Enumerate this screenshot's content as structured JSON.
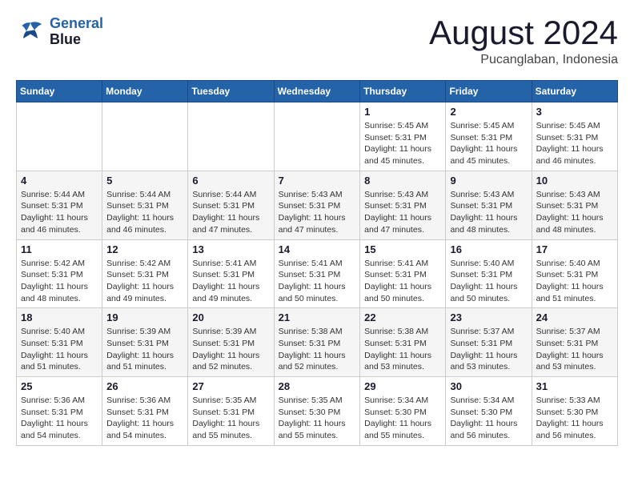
{
  "header": {
    "logo_line1": "General",
    "logo_line2": "Blue",
    "month": "August 2024",
    "location": "Pucanglaban, Indonesia"
  },
  "weekdays": [
    "Sunday",
    "Monday",
    "Tuesday",
    "Wednesday",
    "Thursday",
    "Friday",
    "Saturday"
  ],
  "weeks": [
    [
      {
        "day": "",
        "info": ""
      },
      {
        "day": "",
        "info": ""
      },
      {
        "day": "",
        "info": ""
      },
      {
        "day": "",
        "info": ""
      },
      {
        "day": "1",
        "info": "Sunrise: 5:45 AM\nSunset: 5:31 PM\nDaylight: 11 hours\nand 45 minutes."
      },
      {
        "day": "2",
        "info": "Sunrise: 5:45 AM\nSunset: 5:31 PM\nDaylight: 11 hours\nand 45 minutes."
      },
      {
        "day": "3",
        "info": "Sunrise: 5:45 AM\nSunset: 5:31 PM\nDaylight: 11 hours\nand 46 minutes."
      }
    ],
    [
      {
        "day": "4",
        "info": "Sunrise: 5:44 AM\nSunset: 5:31 PM\nDaylight: 11 hours\nand 46 minutes."
      },
      {
        "day": "5",
        "info": "Sunrise: 5:44 AM\nSunset: 5:31 PM\nDaylight: 11 hours\nand 46 minutes."
      },
      {
        "day": "6",
        "info": "Sunrise: 5:44 AM\nSunset: 5:31 PM\nDaylight: 11 hours\nand 47 minutes."
      },
      {
        "day": "7",
        "info": "Sunrise: 5:43 AM\nSunset: 5:31 PM\nDaylight: 11 hours\nand 47 minutes."
      },
      {
        "day": "8",
        "info": "Sunrise: 5:43 AM\nSunset: 5:31 PM\nDaylight: 11 hours\nand 47 minutes."
      },
      {
        "day": "9",
        "info": "Sunrise: 5:43 AM\nSunset: 5:31 PM\nDaylight: 11 hours\nand 48 minutes."
      },
      {
        "day": "10",
        "info": "Sunrise: 5:43 AM\nSunset: 5:31 PM\nDaylight: 11 hours\nand 48 minutes."
      }
    ],
    [
      {
        "day": "11",
        "info": "Sunrise: 5:42 AM\nSunset: 5:31 PM\nDaylight: 11 hours\nand 48 minutes."
      },
      {
        "day": "12",
        "info": "Sunrise: 5:42 AM\nSunset: 5:31 PM\nDaylight: 11 hours\nand 49 minutes."
      },
      {
        "day": "13",
        "info": "Sunrise: 5:41 AM\nSunset: 5:31 PM\nDaylight: 11 hours\nand 49 minutes."
      },
      {
        "day": "14",
        "info": "Sunrise: 5:41 AM\nSunset: 5:31 PM\nDaylight: 11 hours\nand 50 minutes."
      },
      {
        "day": "15",
        "info": "Sunrise: 5:41 AM\nSunset: 5:31 PM\nDaylight: 11 hours\nand 50 minutes."
      },
      {
        "day": "16",
        "info": "Sunrise: 5:40 AM\nSunset: 5:31 PM\nDaylight: 11 hours\nand 50 minutes."
      },
      {
        "day": "17",
        "info": "Sunrise: 5:40 AM\nSunset: 5:31 PM\nDaylight: 11 hours\nand 51 minutes."
      }
    ],
    [
      {
        "day": "18",
        "info": "Sunrise: 5:40 AM\nSunset: 5:31 PM\nDaylight: 11 hours\nand 51 minutes."
      },
      {
        "day": "19",
        "info": "Sunrise: 5:39 AM\nSunset: 5:31 PM\nDaylight: 11 hours\nand 51 minutes."
      },
      {
        "day": "20",
        "info": "Sunrise: 5:39 AM\nSunset: 5:31 PM\nDaylight: 11 hours\nand 52 minutes."
      },
      {
        "day": "21",
        "info": "Sunrise: 5:38 AM\nSunset: 5:31 PM\nDaylight: 11 hours\nand 52 minutes."
      },
      {
        "day": "22",
        "info": "Sunrise: 5:38 AM\nSunset: 5:31 PM\nDaylight: 11 hours\nand 53 minutes."
      },
      {
        "day": "23",
        "info": "Sunrise: 5:37 AM\nSunset: 5:31 PM\nDaylight: 11 hours\nand 53 minutes."
      },
      {
        "day": "24",
        "info": "Sunrise: 5:37 AM\nSunset: 5:31 PM\nDaylight: 11 hours\nand 53 minutes."
      }
    ],
    [
      {
        "day": "25",
        "info": "Sunrise: 5:36 AM\nSunset: 5:31 PM\nDaylight: 11 hours\nand 54 minutes."
      },
      {
        "day": "26",
        "info": "Sunrise: 5:36 AM\nSunset: 5:31 PM\nDaylight: 11 hours\nand 54 minutes."
      },
      {
        "day": "27",
        "info": "Sunrise: 5:35 AM\nSunset: 5:31 PM\nDaylight: 11 hours\nand 55 minutes."
      },
      {
        "day": "28",
        "info": "Sunrise: 5:35 AM\nSunset: 5:30 PM\nDaylight: 11 hours\nand 55 minutes."
      },
      {
        "day": "29",
        "info": "Sunrise: 5:34 AM\nSunset: 5:30 PM\nDaylight: 11 hours\nand 55 minutes."
      },
      {
        "day": "30",
        "info": "Sunrise: 5:34 AM\nSunset: 5:30 PM\nDaylight: 11 hours\nand 56 minutes."
      },
      {
        "day": "31",
        "info": "Sunrise: 5:33 AM\nSunset: 5:30 PM\nDaylight: 11 hours\nand 56 minutes."
      }
    ]
  ]
}
